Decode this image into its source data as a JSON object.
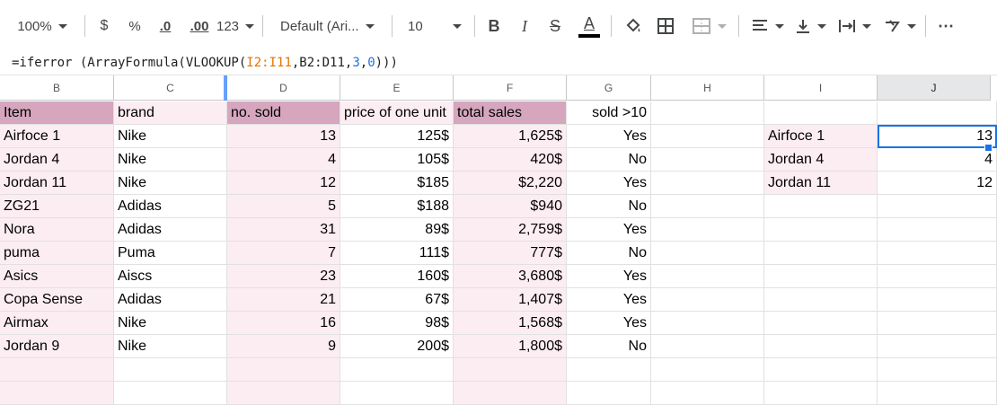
{
  "toolbar": {
    "zoom": "100%",
    "currency": "$",
    "percent": "%",
    "decrease_decimals": ".0",
    "increase_decimals": ".00",
    "number_format": "123",
    "font": "Default (Ari...",
    "font_size": "10",
    "bold": "B",
    "italic": "I",
    "strikethrough": "S",
    "text_color": "A",
    "more": "⋯"
  },
  "formula_bar": {
    "formula": "=iferror (ArrayFormula(VLOOKUP(I2:I11,B2:D11,3,0)))"
  },
  "columns": [
    "B",
    "C",
    "D",
    "E",
    "F",
    "G",
    "H",
    "I",
    "J"
  ],
  "selected_column": "J",
  "header_row": [
    "Item",
    "brand",
    "no. sold",
    "price of one unit",
    "total sales",
    "sold >10"
  ],
  "rows": [
    {
      "item": "Airfoce 1",
      "brand": "Nike",
      "sold": "13",
      "price": "125$",
      "total": "1,625$",
      "over10": "Yes"
    },
    {
      "item": "Jordan 4",
      "brand": "Nike",
      "sold": "4",
      "price": "105$",
      "total": "420$",
      "over10": "No"
    },
    {
      "item": "Jordan 11",
      "brand": "Nike",
      "sold": "12",
      "price": "$185",
      "total": "$2,220",
      "over10": "Yes"
    },
    {
      "item": "ZG21",
      "brand": "Adidas",
      "sold": "5",
      "price": "$188",
      "total": "$940",
      "over10": "No"
    },
    {
      "item": "Nora",
      "brand": "Adidas",
      "sold": "31",
      "price": "89$",
      "total": "2,759$",
      "over10": "Yes"
    },
    {
      "item": "puma",
      "brand": "Puma",
      "sold": "7",
      "price": "111$",
      "total": "777$",
      "over10": "No"
    },
    {
      "item": "Asics",
      "brand": "Aiscs",
      "sold": "23",
      "price": "160$",
      "total": "3,680$",
      "over10": "Yes"
    },
    {
      "item": "Copa Sense",
      "brand": "Adidas",
      "sold": "21",
      "price": "67$",
      "total": "1,407$",
      "over10": "Yes"
    },
    {
      "item": "Airmax",
      "brand": "Nike",
      "sold": "16",
      "price": "98$",
      "total": "1,568$",
      "over10": "Yes"
    },
    {
      "item": "Jordan 9",
      "brand": "Nike",
      "sold": "9",
      "price": "200$",
      "total": "1,800$",
      "over10": "No"
    }
  ],
  "lookup": [
    {
      "item": "Airfoce 1",
      "value": "13"
    },
    {
      "item": "Jordan 4",
      "value": "4"
    },
    {
      "item": "Jordan 11",
      "value": "12"
    }
  ],
  "colors": {
    "header_pink": "#d5a6bd",
    "light_pink": "#fcedf3",
    "selection_blue": "#1a73e8",
    "formula_orange": "#e37400",
    "formula_blue": "#1a73e8"
  }
}
